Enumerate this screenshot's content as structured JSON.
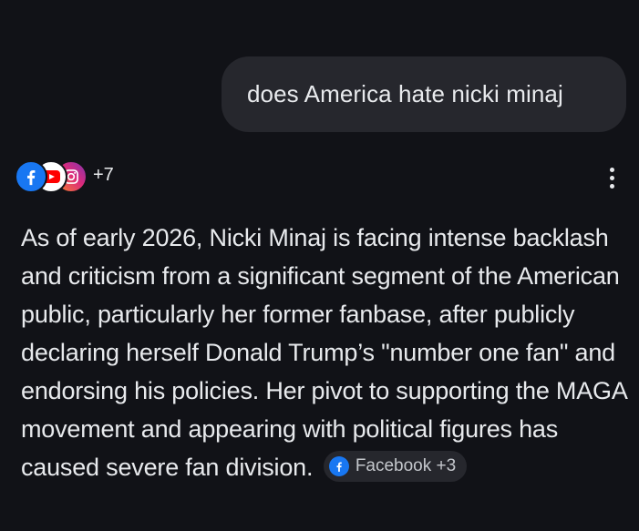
{
  "user_message": {
    "text": "does America hate nicki minaj"
  },
  "sources": {
    "icons": [
      "facebook-icon",
      "youtube-icon",
      "instagram-icon"
    ],
    "more_count_label": "+7"
  },
  "answer": {
    "text": "As of early 2026, Nicki Minaj is facing intense backlash and criticism from a significant segment of the American public, particularly her former fanbase, after publicly declaring herself Donald Trump’s \"number one fan\" and endorsing his policies. Her pivot to supporting the MAGA movement and appearing with political figures has caused severe fan division.",
    "citation_chip": {
      "icon": "facebook-icon",
      "label": "Facebook +3"
    }
  },
  "colors": {
    "background": "#111217",
    "bubble": "#26272d",
    "text": "#e8eaed",
    "facebook_blue": "#1877f2",
    "youtube_red": "#ff0000"
  }
}
